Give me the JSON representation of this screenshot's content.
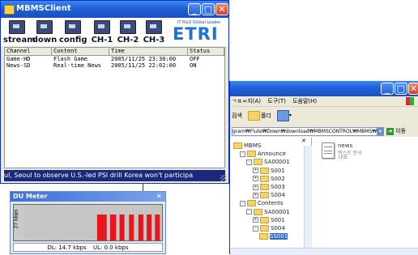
{
  "mbms": {
    "title": "MBMSClient",
    "toolbar": [
      {
        "label": "stream"
      },
      {
        "label": "down"
      },
      {
        "label": "config"
      },
      {
        "label": "CH-1"
      },
      {
        "label": "CH-2"
      },
      {
        "label": "CH-3"
      }
    ],
    "logo_tagline": "IT R&D Global Leader",
    "logo_text": "ETRI",
    "columns": [
      "Channel",
      "Content",
      "Time",
      "Status"
    ],
    "rows": [
      [
        "Game-HD",
        "Flash Game",
        "2005/11/25 23:30:00",
        "OFF"
      ],
      [
        "News-SD",
        "Real-time News",
        "2005/11/25 22:02:00",
        "ON"
      ]
    ],
    "ticker": "ul, Seoul to observe U.S.-led PSI drill Korea won't participa"
  },
  "dumeter": {
    "title": "DU Meter",
    "axis_label": "27 kbps",
    "dl_label": "DL: 14.7 kbps",
    "ul_label": "UL: 0.0 kbps",
    "bar_levels": [
      0,
      0,
      0,
      0,
      0,
      0,
      0,
      0,
      0,
      0,
      0,
      0,
      0,
      0,
      0,
      0,
      0,
      0,
      0,
      0,
      0,
      0,
      0,
      0,
      0,
      0,
      0,
      0,
      0,
      0,
      0,
      0,
      0,
      0,
      0,
      0,
      0,
      0,
      0,
      0,
      0,
      0,
      0,
      0,
      0,
      0,
      0,
      0,
      0,
      0,
      0,
      0,
      0,
      0,
      0,
      0,
      0,
      0,
      0,
      0,
      0,
      1,
      1,
      1,
      1,
      1,
      1,
      1,
      1,
      0,
      0,
      0,
      1,
      1,
      1,
      1,
      1,
      0,
      0,
      0,
      1,
      1,
      1,
      1,
      0,
      0,
      0,
      0,
      1,
      1,
      1,
      1,
      0,
      0,
      0,
      0,
      1,
      1,
      1,
      1,
      0,
      0,
      0,
      1,
      1,
      1,
      1,
      0,
      0,
      0,
      1,
      1,
      1,
      1,
      0,
      0
    ]
  },
  "explorer": {
    "menu": [
      "ㄱㅍㅆ지(A)",
      "도구(T)",
      "도움말(H)"
    ],
    "toolbar": [
      "검색",
      "폴더"
    ],
    "address": "gram₩Flute₩Down₩download₩MBMSCONTROL₩MBMS₩",
    "go_label": "이동",
    "tree": [
      {
        "label": "MBMS",
        "level": 0,
        "expander": ""
      },
      {
        "label": "Announce",
        "level": 1,
        "expander": "-"
      },
      {
        "label": "SA00001",
        "level": 2,
        "expander": "-"
      },
      {
        "label": "S001",
        "level": 3,
        "expander": "+"
      },
      {
        "label": "S002",
        "level": 3,
        "expander": "+"
      },
      {
        "label": "S003",
        "level": 3,
        "expander": "+"
      },
      {
        "label": "S004",
        "level": 3,
        "expander": "+"
      },
      {
        "label": "Contents",
        "level": 1,
        "expander": "-"
      },
      {
        "label": "SA00001",
        "level": 2,
        "expander": "-"
      },
      {
        "label": "S001",
        "level": 3,
        "expander": "+"
      },
      {
        "label": "S004",
        "level": 3,
        "expander": "-"
      },
      {
        "label": "SS001",
        "level": 4,
        "expander": ""
      }
    ],
    "file_name": "news",
    "file_sub1": "텍스트 문서",
    "file_sub2": "1KB"
  },
  "colors": {
    "xp_blue": "#1f5fd6",
    "ticker_bg": "#1a2a7a",
    "meter_red": "#e8141c",
    "meter_bg": "#c9c9c9"
  }
}
